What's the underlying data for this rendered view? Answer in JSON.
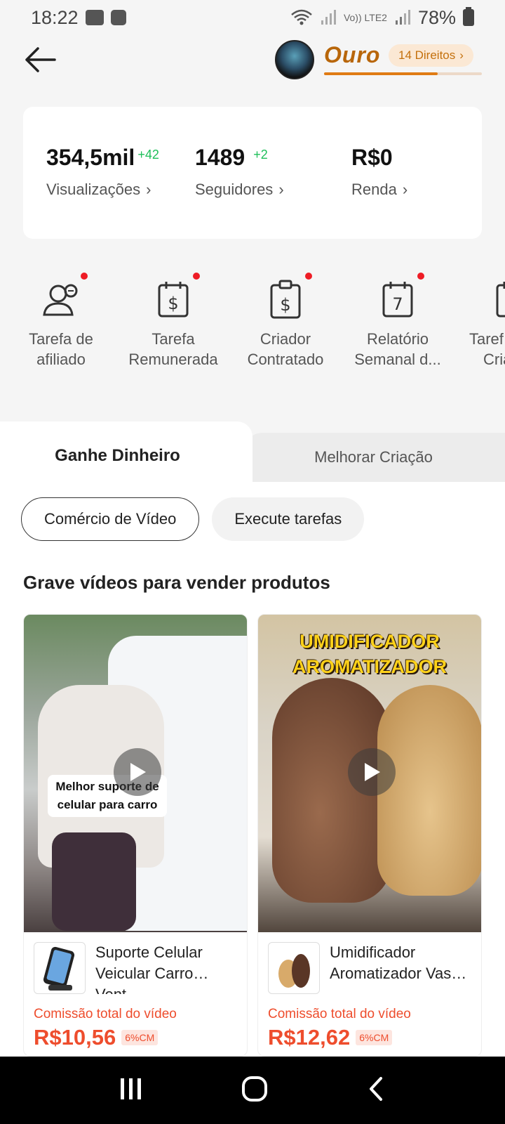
{
  "status_bar": {
    "time": "18:22",
    "network_label": "Vo)) LTE2",
    "battery_pct": "78%"
  },
  "header": {
    "level_name": "Ouro",
    "rights_label": "14 Direitos",
    "level_progress": 0.72
  },
  "stats": [
    {
      "value": "354,5mil",
      "delta": "+42",
      "label": "Visualizações"
    },
    {
      "value": "1489",
      "delta": "+2",
      "label": "Seguidores"
    },
    {
      "value": "R$0",
      "delta": "",
      "label": "Renda"
    }
  ],
  "shortcuts": [
    {
      "label_1": "Tarefa de",
      "label_2": "afiliado",
      "icon": "people-coin-icon",
      "badge": true
    },
    {
      "label_1": "Tarefa",
      "label_2": "Remunerada",
      "icon": "calendar-dollar-icon",
      "badge": true
    },
    {
      "label_1": "Criador",
      "label_2": "Contratado",
      "icon": "clipboard-dollar-icon",
      "badge": true
    },
    {
      "label_1": "Relatório",
      "label_2": "Semanal d...",
      "icon": "calendar-7-icon",
      "badge": true
    },
    {
      "label_1": "Taref",
      "label_2": "Cria",
      "icon": "calendar-icon",
      "badge": false
    }
  ],
  "tabs": {
    "active": "Ganhe Dinheiro",
    "inactive": "Melhorar Criação"
  },
  "chips": {
    "active": "Comércio de Vídeo",
    "inactive": "Execute tarefas"
  },
  "section_title": "Grave vídeos para vender produtos",
  "products": [
    {
      "video_caption": "Melhor suporte de celular para carro",
      "banner": "",
      "name": "Suporte Celular Veicular Carro Vent...",
      "commission_label": "Comissão total do vídeo",
      "price": "R$10,56",
      "pct": "6%CM"
    },
    {
      "video_caption": "",
      "banner": "UMIDIFICADOR AROMATIZADOR",
      "name": "Umidificador Aromatizador Vaso ...",
      "commission_label": "Comissão total do vídeo",
      "price": "R$12,62",
      "pct": "6%CM"
    }
  ],
  "colors": {
    "accent": "#ee4d2d",
    "gold": "#b8660a",
    "delta_green": "#1fbf5a"
  }
}
